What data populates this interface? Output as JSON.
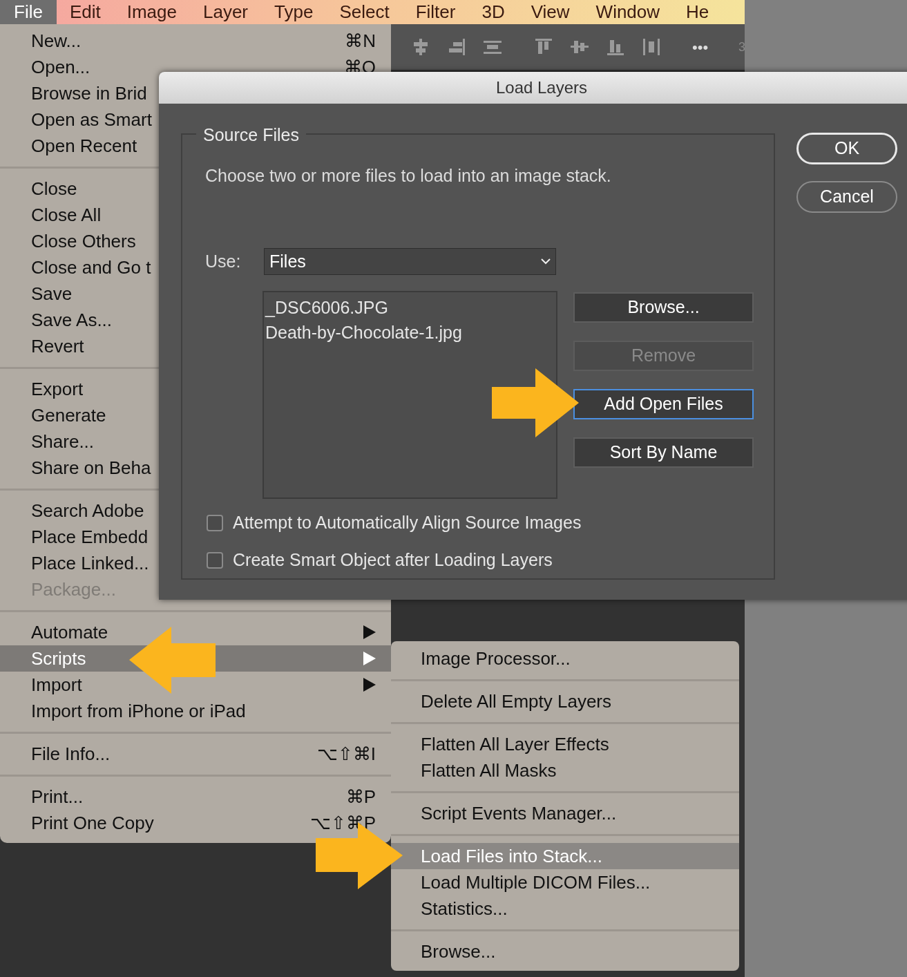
{
  "menu_bar": [
    {
      "label": "File",
      "selected": true
    },
    {
      "label": "Edit",
      "selected": false
    },
    {
      "label": "Image",
      "selected": false
    },
    {
      "label": "Layer",
      "selected": false
    },
    {
      "label": "Type",
      "selected": false
    },
    {
      "label": "Select",
      "selected": false
    },
    {
      "label": "Filter",
      "selected": false
    },
    {
      "label": "3D",
      "selected": false
    },
    {
      "label": "View",
      "selected": false
    },
    {
      "label": "Window",
      "selected": false
    },
    {
      "label": "He",
      "selected": false
    }
  ],
  "toolbar": {
    "more": "•••",
    "cut_label": "3"
  },
  "file_menu": {
    "groups": [
      [
        {
          "label": "New...",
          "shortcut": "⌘N",
          "submenu": false,
          "selected": false,
          "disabled": false
        },
        {
          "label": "Open...",
          "shortcut": "⌘O",
          "submenu": false,
          "selected": false,
          "disabled": false
        },
        {
          "label": "Browse in Brid",
          "selected": false,
          "disabled": false
        },
        {
          "label": "Open as Smart",
          "selected": false,
          "disabled": false
        },
        {
          "label": "Open Recent",
          "selected": false,
          "disabled": false
        }
      ],
      [
        {
          "label": "Close",
          "selected": false,
          "disabled": false
        },
        {
          "label": "Close All",
          "selected": false,
          "disabled": false
        },
        {
          "label": "Close Others",
          "selected": false,
          "disabled": false
        },
        {
          "label": "Close and Go t",
          "selected": false,
          "disabled": false
        },
        {
          "label": "Save",
          "selected": false,
          "disabled": false
        },
        {
          "label": "Save As...",
          "selected": false,
          "disabled": false
        },
        {
          "label": "Revert",
          "selected": false,
          "disabled": false
        }
      ],
      [
        {
          "label": "Export",
          "selected": false,
          "disabled": false
        },
        {
          "label": "Generate",
          "selected": false,
          "disabled": false
        },
        {
          "label": "Share...",
          "selected": false,
          "disabled": false
        },
        {
          "label": "Share on Beha",
          "selected": false,
          "disabled": false
        }
      ],
      [
        {
          "label": "Search Adobe",
          "selected": false,
          "disabled": false
        },
        {
          "label": "Place Embedd",
          "selected": false,
          "disabled": false
        },
        {
          "label": "Place Linked...",
          "selected": false,
          "disabled": false
        },
        {
          "label": "Package...",
          "selected": false,
          "disabled": true
        }
      ],
      [
        {
          "label": "Automate",
          "submenu": true,
          "selected": false,
          "disabled": false
        },
        {
          "label": "Scripts",
          "submenu": true,
          "selected": true,
          "disabled": false
        },
        {
          "label": "Import",
          "submenu": true,
          "selected": false,
          "disabled": false
        },
        {
          "label": "Import from iPhone or iPad",
          "submenu": false,
          "selected": false,
          "disabled": false
        }
      ],
      [
        {
          "label": "File Info...",
          "shortcut": "⌥⇧⌘I",
          "submenu": false,
          "selected": false,
          "disabled": false
        }
      ],
      [
        {
          "label": "Print...",
          "shortcut": "⌘P",
          "submenu": false,
          "selected": false,
          "disabled": false
        },
        {
          "label": "Print One Copy",
          "shortcut": "⌥⇧⌘P",
          "submenu": false,
          "selected": false,
          "disabled": false
        }
      ]
    ]
  },
  "scripts_submenu": {
    "groups": [
      [
        {
          "label": "Image Processor...",
          "selected": false
        }
      ],
      [
        {
          "label": "Delete All Empty Layers",
          "selected": false
        }
      ],
      [
        {
          "label": "Flatten All Layer Effects",
          "selected": false
        },
        {
          "label": "Flatten All Masks",
          "selected": false
        }
      ],
      [
        {
          "label": "Script Events Manager...",
          "selected": false
        }
      ],
      [
        {
          "label": "Load Files into Stack...",
          "selected": true
        },
        {
          "label": "Load Multiple DICOM Files...",
          "selected": false
        },
        {
          "label": "Statistics...",
          "selected": false
        }
      ],
      [
        {
          "label": "Browse...",
          "selected": false
        }
      ]
    ]
  },
  "dialog": {
    "title": "Load Layers",
    "group_title": "Source Files",
    "description": "Choose two or more files to load into an image stack.",
    "use_label": "Use:",
    "use_value": "Files",
    "files": [
      "_DSC6006.JPG",
      "Death-by-Chocolate-1.jpg"
    ],
    "list_buttons": [
      {
        "label": "Browse...",
        "disabled": false,
        "focused": false
      },
      {
        "label": "Remove",
        "disabled": true,
        "focused": false
      },
      {
        "label": "Add Open Files",
        "disabled": false,
        "focused": true
      },
      {
        "label": "Sort By Name",
        "disabled": false,
        "focused": false
      }
    ],
    "checkboxes": [
      {
        "label": "Attempt to Automatically Align Source Images",
        "checked": false
      },
      {
        "label": "Create Smart Object after Loading Layers",
        "checked": false
      }
    ],
    "side_buttons": [
      {
        "label": "OK",
        "default": true
      },
      {
        "label": "Cancel",
        "default": false
      }
    ]
  }
}
